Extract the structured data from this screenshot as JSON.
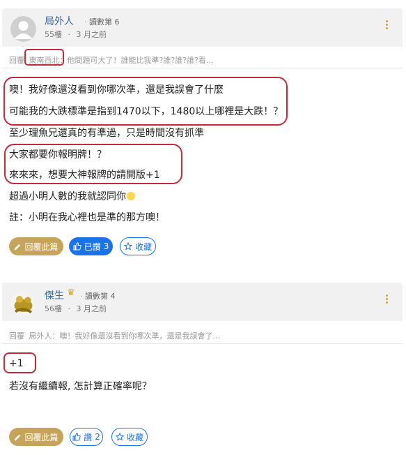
{
  "posts": [
    {
      "username": "局外人",
      "rank": "讀數第 6",
      "floor": "55樓",
      "time": "3 月之前",
      "quote": {
        "prefix": "回覆",
        "user": "東南西北",
        "text": "：他問題可大了！誰能比我準?誰?誰?誰?看..."
      },
      "lines": [
        "噢！我好像還沒看到你哪次準，還是我誤會了什麼",
        "可能我的大跌標準是指到1470以下，1480以上哪裡是大跌！？",
        "至少理魚兄還真的有準過，只是時間沒有抓準",
        "大家都要你報明牌！？",
        "來來來，想要大神報牌的請開版+1",
        "超過小明人數的我就認同你",
        "註：小明在我心裡也是準的那方噢！"
      ],
      "actions": {
        "reply": "回覆此篇",
        "like": "已讚",
        "like_count": "3",
        "favorite": "收藏"
      }
    },
    {
      "username": "傑生",
      "rank": "讀數第 4",
      "floor": "56樓",
      "time": "3 月之前",
      "quote": {
        "prefix": "回覆",
        "user": "局外人",
        "text": "：噢！我好像還沒看到你哪次準，還是我誤會了..."
      },
      "lines": [
        "+1",
        "若沒有繼續報, 怎計算正確率呢？"
      ],
      "actions": {
        "reply": "回覆此篇",
        "like": "讚",
        "like_count": "2",
        "favorite": "收藏"
      }
    }
  ],
  "icons": {
    "more": "more-vertical-icon",
    "pencil": "pencil-icon",
    "thumbs_up": "thumbs-up-icon",
    "star": "star-outline-icon",
    "crown": "crown-icon",
    "emoji": "smiley-emoji-icon"
  },
  "colors": {
    "accent_gold": "#c6a55b",
    "accent_blue": "#1a73e8",
    "highlight_red": "#c62a3a",
    "username": "#3a6a9a"
  }
}
